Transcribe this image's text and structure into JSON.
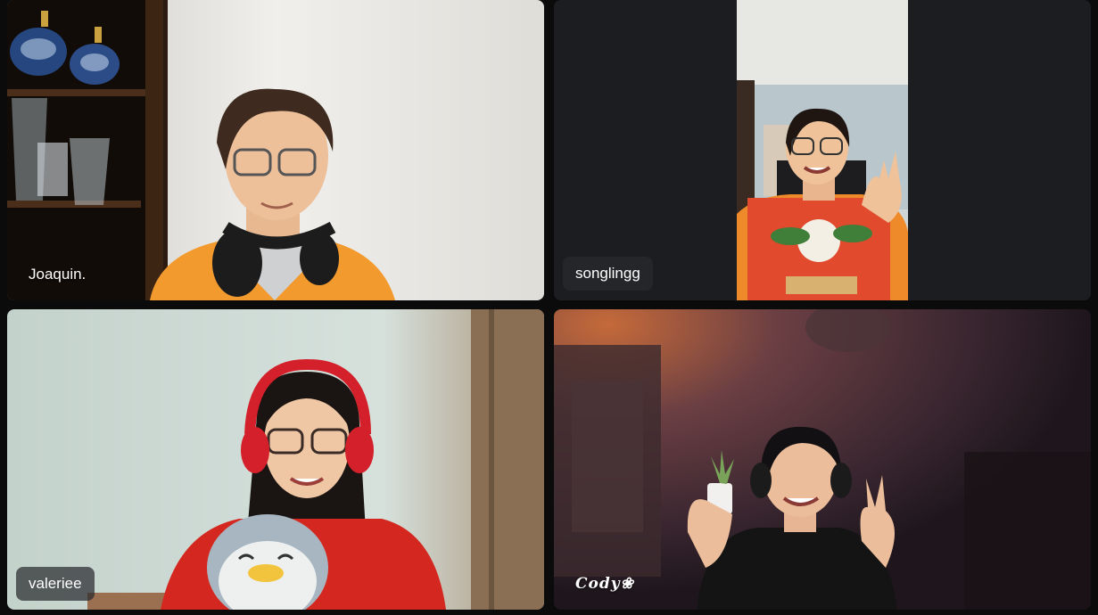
{
  "participants": [
    {
      "name": "Joaquin.",
      "background": "#d9d7d2",
      "shirt": "#f39a2f",
      "headphones": "#1c1c1c"
    },
    {
      "name": "songlingg",
      "background": "#1c1d20",
      "shirt": "#e14a2c",
      "headphones": ""
    },
    {
      "name": "valeriee",
      "background": "#cfd9d4",
      "shirt": "#d4271f",
      "headphones": "#d4202a"
    },
    {
      "name": "Cody❀",
      "background": "#2b1d22",
      "shirt": "#141414",
      "headphones": "#1b1b1b"
    }
  ],
  "colors": {
    "grid_background": "#0b0b0c",
    "name_tag_background": "#2a2c2e",
    "name_text": "#ffffff"
  },
  "icons": {
    "flower": "❀"
  }
}
